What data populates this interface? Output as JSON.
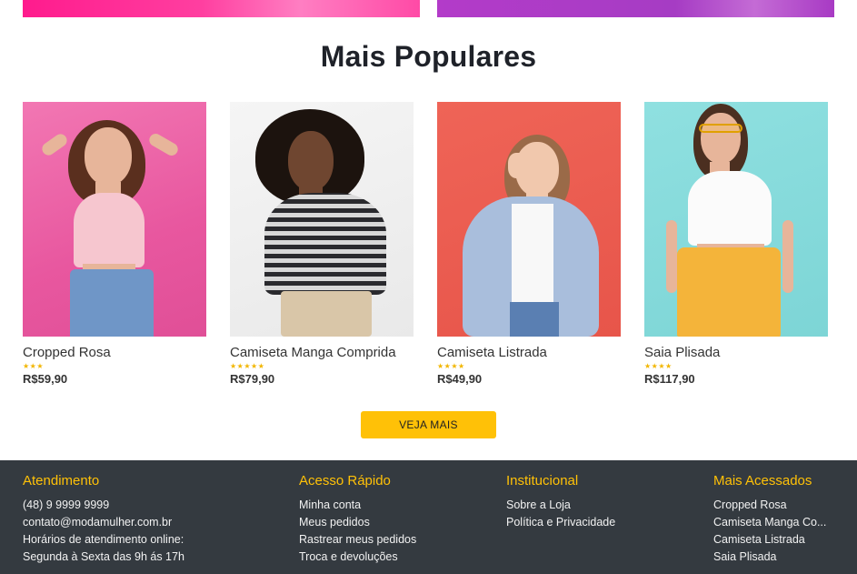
{
  "page": {
    "section_title": "Mais Populares",
    "view_more_label": "VEJA MAIS"
  },
  "products": [
    {
      "name": "Cropped Rosa",
      "rating": 3,
      "stars_text": "★★★",
      "price": "R$59,90"
    },
    {
      "name": "Camiseta Manga Comprida",
      "rating": 5,
      "stars_text": "★★★★★",
      "price": "R$79,90"
    },
    {
      "name": "Camiseta Listrada",
      "rating": 4,
      "stars_text": "★★★★",
      "price": "R$49,90"
    },
    {
      "name": "Saia Plisada",
      "rating": 4,
      "stars_text": "★★★★",
      "price": "R$117,90"
    }
  ],
  "footer": {
    "atendimento": {
      "title": "Atendimento",
      "lines": [
        "(48) 9 9999 9999",
        "contato@modamulher.com.br",
        "Horários de atendimento online:",
        "Segunda à Sexta das 9h ás 17h"
      ]
    },
    "acesso_rapido": {
      "title": "Acesso Rápido",
      "links": [
        "Minha conta",
        "Meus pedidos",
        "Rastrear meus pedidos",
        "Troca e devoluções"
      ]
    },
    "institucional": {
      "title": "Institucional",
      "links": [
        "Sobre a Loja",
        "Política e Privacidade"
      ]
    },
    "mais_acessados": {
      "title": "Mais Acessados",
      "links": [
        "Cropped Rosa",
        "Camiseta Manga Co...",
        "Camiseta Listrada",
        "Saia Plisada"
      ]
    }
  },
  "colors": {
    "accent": "#ffc107",
    "footer_bg": "#343a40",
    "star": "#f2b600"
  }
}
